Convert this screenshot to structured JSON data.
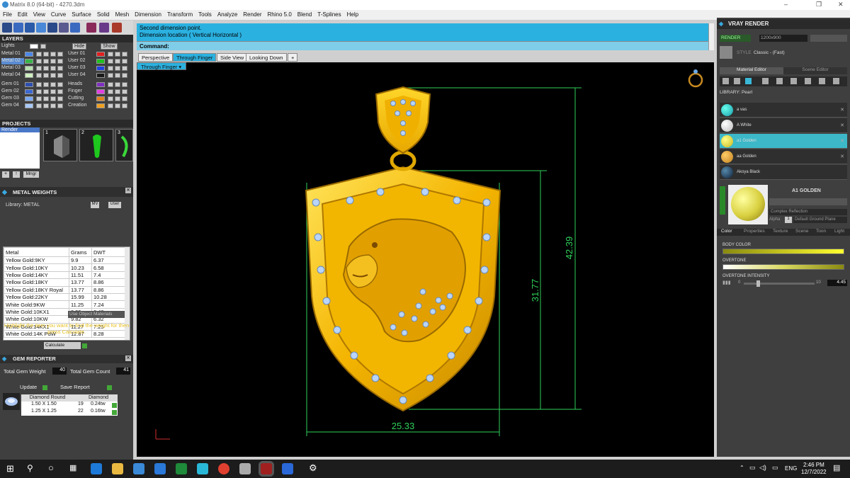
{
  "window": {
    "title": "Matrix 8.0 (64-bit) - 4270.3dm"
  },
  "menu": [
    "File",
    "Edit",
    "View",
    "Curve",
    "Surface",
    "Solid",
    "Mesh",
    "Dimension",
    "Transform",
    "Tools",
    "Analyze",
    "Render",
    "Rhino 5.0",
    "Blend",
    "T-Splines",
    "Help"
  ],
  "layers": {
    "title": "LAYERS",
    "hide_label": "Hide",
    "show_label": "Show",
    "left": [
      {
        "name": "Lights",
        "color": "#ffffff"
      },
      {
        "name": "Metal 01",
        "color": "#4a86e8"
      },
      {
        "name": "Metal 02",
        "color": "#39b54a"
      },
      {
        "name": "Metal 03",
        "color": "#b8e0b0"
      },
      {
        "name": "Metal 04",
        "color": "#d0f0c0"
      },
      {
        "name": "Gem 01",
        "color": "#2d4fb0"
      },
      {
        "name": "Gem 02",
        "color": "#3b67d0"
      },
      {
        "name": "Gem 03",
        "color": "#7aa8f0"
      },
      {
        "name": "Gem 04",
        "color": "#a8c8f8"
      }
    ],
    "right": [
      {
        "name": "User 01",
        "color": "#e02020"
      },
      {
        "name": "User 02",
        "color": "#20c020"
      },
      {
        "name": "User 03",
        "color": "#2040e0"
      },
      {
        "name": "User 04",
        "color": "#1a1a1a"
      },
      {
        "name": "Heads",
        "color": "#8030c0"
      },
      {
        "name": "Finger",
        "color": "#e040e0"
      },
      {
        "name": "Cutting",
        "color": "#e08020"
      },
      {
        "name": "Creation",
        "color": "#f0a020"
      }
    ]
  },
  "projects": {
    "title": "PROJECTS",
    "item": "Render",
    "thumbs": [
      "1",
      "2",
      "3"
    ],
    "button_label": "Mngr"
  },
  "metal_weights": {
    "title": "METAL WEIGHTS",
    "library_label": "Library: METAL",
    "mv": "MV",
    "user": "User",
    "columns": [
      "Metal",
      "Grams",
      "DWT"
    ],
    "rows": [
      [
        "Yellow Gold:9KY",
        "9.9",
        "6.37"
      ],
      [
        "Yellow Gold:10KY",
        "10.23",
        "6.58"
      ],
      [
        "Yellow Gold:14KY",
        "11.51",
        "7.4"
      ],
      [
        "Yellow Gold:18KY",
        "13.77",
        "8.86"
      ],
      [
        "Yellow Gold:18KY Royal",
        "13.77",
        "8.86"
      ],
      [
        "Yellow Gold:22KY",
        "15.99",
        "10.28"
      ],
      [
        "White Gold:9KW",
        "11.25",
        "7.24"
      ],
      [
        "White Gold:10KX1",
        "9.99",
        "6.42"
      ],
      [
        "White Gold:10KW",
        "9.82",
        "6.32"
      ],
      [
        "White Gold:14KX1",
        "11.27",
        "7.25"
      ],
      [
        "White Gold:14K PdW",
        "12.87",
        "8.28"
      ]
    ],
    "use_object": "Use Object Materials",
    "hint": "Highlight the item you want to find the weight for then press Calculate.",
    "calculate": "Calculate"
  },
  "gem_reporter": {
    "title": "GEM REPORTER",
    "total_weight_label": "Total Gem Weight",
    "total_weight": "40",
    "total_count_label": "Total Gem Count",
    "total_count": "41",
    "update": "Update",
    "save_report": "Save Report",
    "columns": [
      "Diamond Round",
      "Diamond"
    ],
    "rows": [
      [
        "1.50 X 1.50",
        "19",
        "0.24tw"
      ],
      [
        "1.25 X 1.25",
        "22",
        "0.16tw"
      ]
    ]
  },
  "command": {
    "line1": "Second dimension point.",
    "line2": "Dimension location ( Vertical  Horizontal )",
    "label": "Command:"
  },
  "tabs": [
    {
      "label": "Perspective",
      "active": false
    },
    {
      "label": "Through Finger",
      "active": true
    },
    {
      "label": "Side View",
      "active": false
    },
    {
      "label": "Looking Down",
      "active": false
    },
    {
      "label": "+",
      "active": false
    }
  ],
  "subtab": "Through Finger",
  "dimensions": {
    "width": "25.33",
    "height_total": "42.39",
    "height_shield": "31.77"
  },
  "vray": {
    "title": "VRAY RENDER",
    "render_label": "RENDER",
    "resolution": "1200x900",
    "style_label": "STYLE",
    "style_value": "Classic - (Fast)",
    "tab_material": "Material Editor",
    "tab_scene": "Scene Editor",
    "library_label": "LIBRARY: Pearl",
    "materials": [
      {
        "name": "a vas",
        "color": "#1a9aa8",
        "selected": false
      },
      {
        "name": "A White",
        "color": "#e0e0e0",
        "selected": false
      },
      {
        "name": "a1 Golden",
        "color": "#d8d040",
        "selected": true
      },
      {
        "name": "aa Golden",
        "color": "#d09030",
        "selected": false
      },
      {
        "name": "Akoya Black",
        "color": "#203048",
        "selected": false
      }
    ],
    "preview_name": "A1 GOLDEN",
    "complex_reflection": "Complex Reflection",
    "alpha_label": "Alpha",
    "alpha_value": "1",
    "ground_plane": "Default Ground Plane",
    "prop_tabs": [
      "Color",
      "Properties",
      "Texture",
      "Scene",
      "Toon",
      "Light"
    ],
    "body_color_label": "BODY COLOR",
    "overtone_label": "OVERTONE",
    "intensity_label": "OVERTONE INTENSITY",
    "intensity_min": "0",
    "intensity_max": "10",
    "intensity_value": "4.45"
  },
  "taskbar": {
    "lang": "ENG",
    "time": "2:46 PM",
    "date": "12/7/2022"
  }
}
